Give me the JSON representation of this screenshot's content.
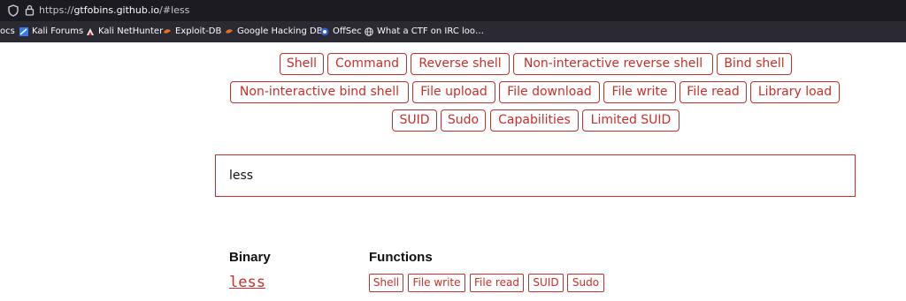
{
  "browser": {
    "url_prefix": "https://",
    "url_host": "gtfobins.github.io",
    "url_path": "/#less",
    "bookmarks": [
      {
        "label": "ocs",
        "icon": "none"
      },
      {
        "label": "Kali Forums",
        "icon": "kali-icon"
      },
      {
        "label": "Kali NetHunter",
        "icon": "nethunter-icon"
      },
      {
        "label": "Exploit-DB",
        "icon": "exploit-db-icon"
      },
      {
        "label": "Google Hacking DB",
        "icon": "ghdb-icon"
      },
      {
        "label": "OffSec",
        "icon": "offsec-icon"
      },
      {
        "label": "What a CTF on IRC loo…",
        "icon": "globe-icon"
      }
    ]
  },
  "filters": {
    "tags": [
      "Shell",
      "Command",
      "Reverse shell",
      "Non-interactive reverse shell",
      "Bind shell",
      "Non-interactive bind shell",
      "File upload",
      "File download",
      "File write",
      "File read",
      "Library load",
      "SUID",
      "Sudo",
      "Capabilities",
      "Limited SUID"
    ]
  },
  "search": {
    "value": "less"
  },
  "results": {
    "binary_header": "Binary",
    "functions_header": "Functions",
    "rows": [
      {
        "binary": "less",
        "functions": [
          "Shell",
          "File write",
          "File read",
          "SUID",
          "Sudo"
        ]
      }
    ]
  },
  "colors": {
    "accent": "#c4302b",
    "toolbar": "#1c1b22",
    "bookmarks_bar": "#2b2a33"
  }
}
